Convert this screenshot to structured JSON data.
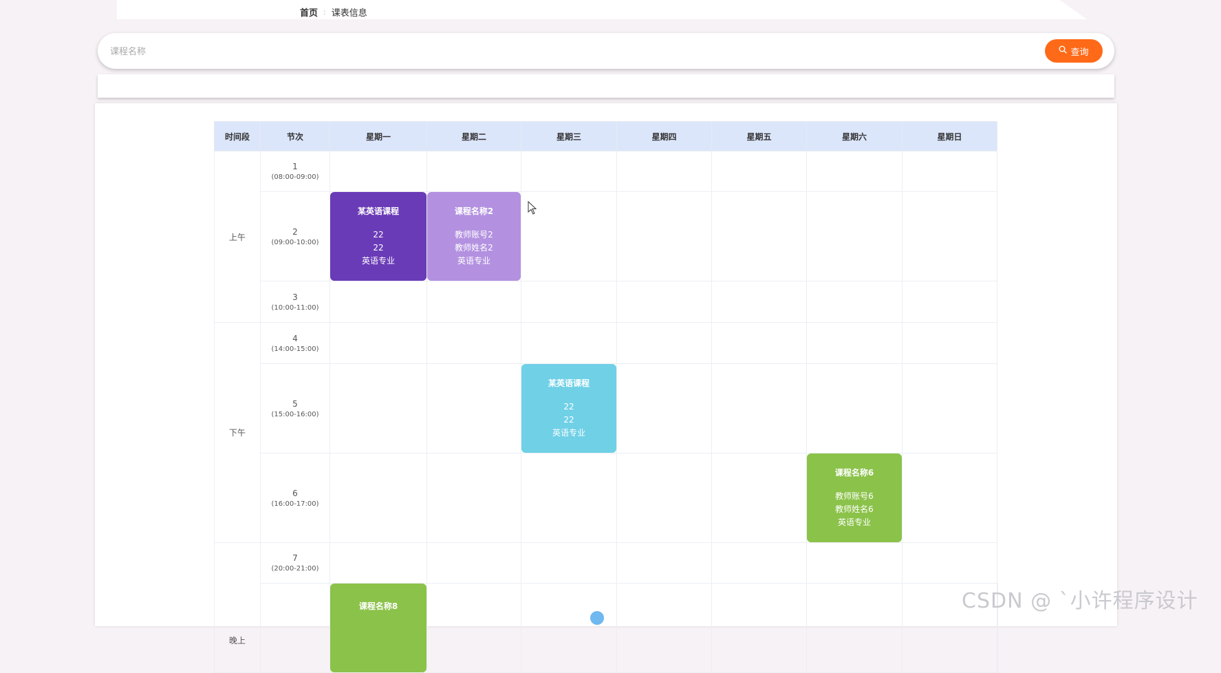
{
  "breadcrumb": {
    "home": "首页",
    "separator": ":",
    "current": "课表信息"
  },
  "search": {
    "placeholder": "课程名称",
    "value": "",
    "button_label": "查询"
  },
  "timetable": {
    "headers": [
      "时间段",
      "节次",
      "星期一",
      "星期二",
      "星期三",
      "星期四",
      "星期五",
      "星期六",
      "星期日"
    ],
    "periods": [
      "上午",
      "下午",
      "晚上"
    ],
    "slots": [
      {
        "num": "1",
        "time": "(08:00-09:00)"
      },
      {
        "num": "2",
        "time": "(09:00-10:00)"
      },
      {
        "num": "3",
        "time": "(10:00-11:00)"
      },
      {
        "num": "4",
        "time": "(14:00-15:00)"
      },
      {
        "num": "5",
        "time": "(15:00-16:00)"
      },
      {
        "num": "6",
        "time": "(16:00-17:00)"
      },
      {
        "num": "7",
        "time": "(20:00-21:00)"
      }
    ],
    "courses": [
      {
        "slot": "2",
        "day": "星期一",
        "name": "某英语课程",
        "line1": "22",
        "line2": "22",
        "major": "英语专业",
        "color": "#6a3bb7"
      },
      {
        "slot": "2",
        "day": "星期二",
        "name": "课程名称2",
        "line1": "教师账号2",
        "line2": "教师姓名2",
        "major": "英语专业",
        "color": "#b391e0"
      },
      {
        "slot": "5",
        "day": "星期三",
        "name": "某英语课程",
        "line1": "22",
        "line2": "22",
        "major": "英语专业",
        "color": "#6fd0e6"
      },
      {
        "slot": "6",
        "day": "星期六",
        "name": "课程名称6",
        "line1": "教师账号6",
        "line2": "教师姓名6",
        "major": "英语专业",
        "color": "#8bc24a"
      },
      {
        "slot": "8",
        "day": "星期一",
        "name": "课程名称8",
        "color": "#8bc24a"
      }
    ]
  },
  "watermark": "CSDN @ ˋ小许程序设计",
  "colors": {
    "accent": "#ff6a18",
    "header_bg": "#dce6fb"
  }
}
